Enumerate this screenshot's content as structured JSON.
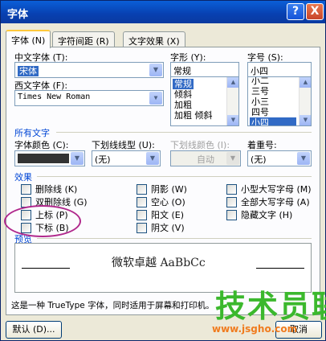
{
  "window": {
    "title": "字体",
    "help_button": "?",
    "close_button": "X"
  },
  "tabs": [
    "字体 (N)",
    "字符间距 (R)",
    "文字效果 (X)"
  ],
  "font": {
    "chinese_label": "中文字体 (T):",
    "chinese_value": "宋体",
    "western_label": "西文字体 (F):",
    "western_value": "Times New Roman"
  },
  "style": {
    "label": "字形 (Y):",
    "value": "常规",
    "options": [
      "常规",
      "倾斜",
      "加粗",
      "加粗 倾斜"
    ],
    "selected": "常规"
  },
  "size": {
    "label": "字号 (S):",
    "value": "小四",
    "options": [
      "小二",
      "三号",
      "小三",
      "四号",
      "小四"
    ],
    "selected": "小四"
  },
  "all_text": {
    "section": "所有文字",
    "color_label": "字体颜色 (C):",
    "underline_label": "下划线线型 (U):",
    "underline_value": "(无)",
    "underline_color_label": "下划线颜色 (I):",
    "underline_color_value": "自动",
    "emphasis_label": "着重号:",
    "emphasis_value": "(无)"
  },
  "effects": {
    "section": "效果",
    "col1": [
      "删除线 (K)",
      "双删除线 (G)",
      "上标 (P)",
      "下标 (B)"
    ],
    "col2": [
      "阴影 (W)",
      "空心 (O)",
      "阳文 (E)",
      "阴文 (V)"
    ],
    "col3": [
      "小型大写字母 (M)",
      "全部大写字母 (A)",
      "隐藏文字 (H)"
    ]
  },
  "preview": {
    "section": "预览",
    "sample": "微软卓越  AaBbCc"
  },
  "note": "这是一种 TrueType 字体，同时适用于屏幕和打印机。",
  "buttons": {
    "default": "默认 (D)...",
    "cancel": "取消"
  },
  "watermark": {
    "big": "技术员联盟",
    "small": "www.jsgho.com"
  },
  "colors": {
    "selection": "#316ac5",
    "title_bar": "#0a5fd8",
    "annotation": "#b0288c"
  }
}
